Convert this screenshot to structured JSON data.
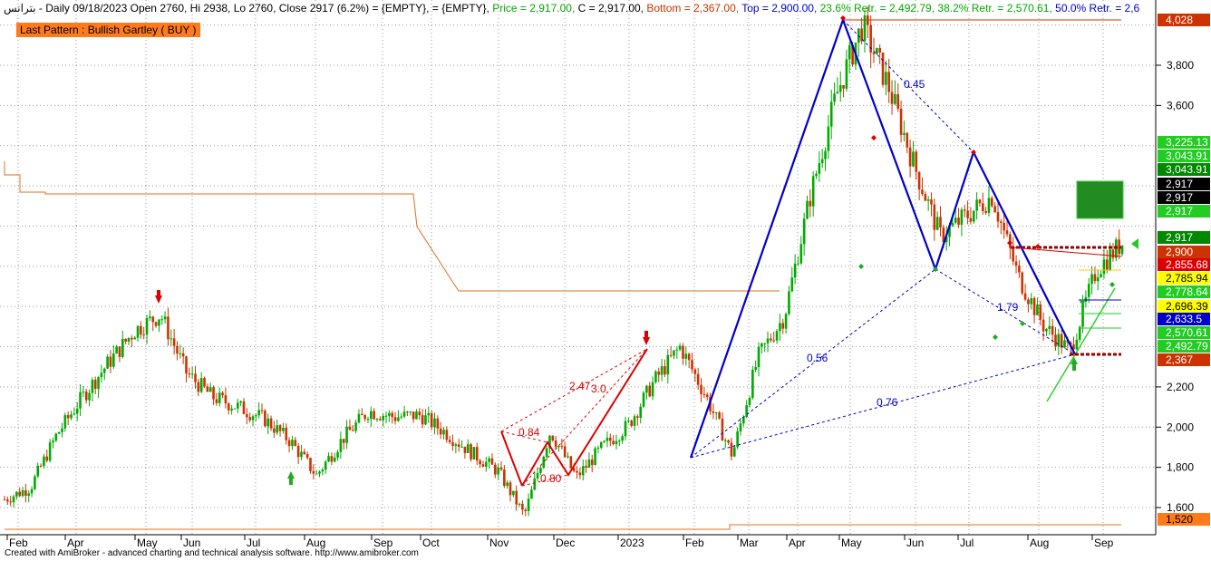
{
  "header": {
    "symbol": "بترانس",
    "segments": [
      {
        "text": " - Daily 09/18/2023 Open 2760, Hi 2938, Lo 2760, Close 2917 (6.2%)",
        "color": "#000000"
      },
      {
        "text": "  = {EMPTY},",
        "color": "#000000"
      },
      {
        "text": "  = {EMPTY},",
        "color": "#000000"
      },
      {
        "text": " Price = 2,917.00,",
        "color": "#00aa00"
      },
      {
        "text": " C = 2,917.00,",
        "color": "#000000"
      },
      {
        "text": " Bottom = 2,367.00,",
        "color": "#cc3300"
      },
      {
        "text": " Top = 2,900.00,",
        "color": "#0000cc"
      },
      {
        "text": " 23.6% Retr. = 2,492.79,",
        "color": "#00aa00"
      },
      {
        "text": " 38.2% Retr. = 2,570.61,",
        "color": "#00aa00"
      },
      {
        "text": " 50.0% Retr. = 2,6",
        "color": "#0000cc"
      }
    ]
  },
  "pattern_label": "Last Pattern : Bullish Gartley ( BUY )",
  "footer": "Created with AmiBroker - advanced charting and technical analysis software. http://www.amibroker.com",
  "colors": {
    "up": "#00aa00",
    "down": "#cc3300",
    "pattern": "#0000cc",
    "stop": "#e07020",
    "red_pattern": "#dd0000"
  },
  "chart_data": {
    "type": "candlestick",
    "x_axis_labels": [
      "Feb",
      "Apr",
      "May",
      "Jun",
      "Jul",
      "Aug",
      "Sep",
      "Oct",
      "Nov",
      "Dec",
      "2023",
      "Feb",
      "Mar",
      "Apr",
      "May",
      "Jun",
      "Jul",
      "Aug",
      "Sep"
    ],
    "y_ticks": [
      "1,600",
      "1,800",
      "2,000",
      "2,200",
      "3,600",
      "3,800"
    ],
    "ylim": [
      1500,
      4100
    ],
    "close_path": [
      [
        "Feb",
        1640
      ],
      [
        "Feb",
        1700
      ],
      [
        "Apr",
        1960
      ],
      [
        "Apr",
        2150
      ],
      [
        "May",
        2320
      ],
      [
        "May",
        2480
      ],
      [
        "May",
        2560
      ],
      [
        "Jun",
        2270
      ],
      [
        "Jun",
        2150
      ],
      [
        "Jun",
        2100
      ],
      [
        "Jul",
        2040
      ],
      [
        "Jul",
        1930
      ],
      [
        "Jul",
        1760
      ],
      [
        "Aug",
        1940
      ],
      [
        "Aug",
        2080
      ],
      [
        "Aug",
        2050
      ],
      [
        "Sep",
        2060
      ],
      [
        "Sep",
        1970
      ],
      [
        "Oct",
        1870
      ],
      [
        "Oct",
        1780
      ],
      [
        "Oct",
        1560
      ],
      [
        "Nov",
        1980
      ],
      [
        "Nov",
        1750
      ],
      [
        "Dec",
        1900
      ],
      [
        "Dec",
        2010
      ],
      [
        "2023",
        2230
      ],
      [
        "2023",
        2400
      ],
      [
        "Feb",
        2150
      ],
      [
        "Feb",
        1860
      ],
      [
        "Mar",
        2350
      ],
      [
        "Mar",
        2550
      ],
      [
        "Apr",
        3150
      ],
      [
        "Apr",
        3650
      ],
      [
        "May",
        4000
      ],
      [
        "May",
        3700
      ],
      [
        "May",
        3300
      ],
      [
        "Jun",
        2950
      ],
      [
        "Jun",
        3050
      ],
      [
        "Jul",
        3150
      ],
      [
        "Jul",
        2750
      ],
      [
        "Aug",
        2500
      ],
      [
        "Aug",
        2380
      ],
      [
        "Sep",
        2780
      ],
      [
        "Sep",
        2917
      ]
    ],
    "price_tags": [
      {
        "label": "4,028",
        "value": 4028,
        "bg": "#cc3300",
        "fg": "#ffffff"
      },
      {
        "label": "3,225.13",
        "value": 3225.13,
        "bg": "#22cc22",
        "fg": "#ffffff"
      },
      {
        "label": "3,043.91",
        "value": 3133,
        "bg": "#22cc22",
        "fg": "#ffffff"
      },
      {
        "label": "3,043.91",
        "value": 3043.91,
        "bg": "#008800",
        "fg": "#ffffff"
      },
      {
        "label": "2,917",
        "value": 2985,
        "bg": "#000000",
        "fg": "#ffffff"
      },
      {
        "label": "2,917",
        "value": 2952,
        "bg": "#000000",
        "fg": "#ffffff"
      },
      {
        "label": "2,917",
        "value": 2917,
        "bg": "#22cc22",
        "fg": "#ffffff"
      },
      {
        "label": "2,917",
        "value": 2880,
        "bg": "#008800",
        "fg": "#ffffff"
      },
      {
        "label": "2,900",
        "value": 2845,
        "bg": "#cc3300",
        "fg": "#ffffff"
      },
      {
        "label": "2,855.68",
        "value": 2810,
        "bg": "#dd0000",
        "fg": "#ffffff"
      },
      {
        "label": "2,785.94",
        "value": 2775,
        "bg": "#ffff00",
        "fg": "#000000"
      },
      {
        "label": "2,778.64",
        "value": 2740,
        "bg": "#22cc22",
        "fg": "#ffffff"
      },
      {
        "label": "2,696.39",
        "value": 2703,
        "bg": "#ffff00",
        "fg": "#000000"
      },
      {
        "label": "2,633.5",
        "value": 2668,
        "bg": "#0000cc",
        "fg": "#ffffff"
      },
      {
        "label": "2,570.61",
        "value": 2633,
        "bg": "#22cc22",
        "fg": "#ffffff"
      },
      {
        "label": "2,492.79",
        "value": 2598,
        "bg": "#22cc22",
        "fg": "#ffffff"
      },
      {
        "label": "2,367",
        "value": 2560,
        "bg": "#cc3300",
        "fg": "#ffffff"
      },
      {
        "label": "1,520",
        "value": 1520,
        "bg": "#ff7a1a",
        "fg": "#000000"
      }
    ],
    "ratio_labels": [
      {
        "text": "0.45",
        "color": "#0000cc"
      },
      {
        "text": "0.56",
        "color": "#0000cc"
      },
      {
        "text": "0.76",
        "color": "#0000cc"
      },
      {
        "text": "1.79",
        "color": "#0000cc"
      },
      {
        "text": "2.47",
        "color": "#dd0000"
      },
      {
        "text": "0.84",
        "color": "#dd0000"
      },
      {
        "text": "0.80",
        "color": "#dd0000"
      },
      {
        "text": "3.0",
        "color": "#dd0000"
      }
    ]
  }
}
